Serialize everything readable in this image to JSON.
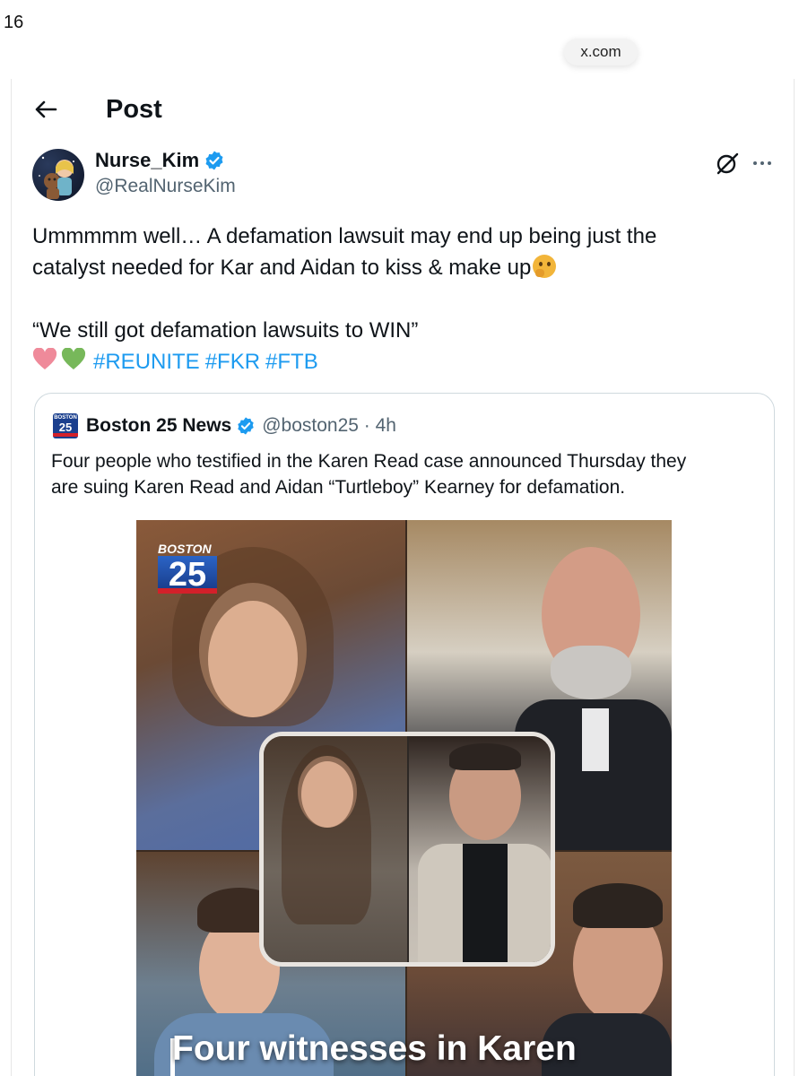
{
  "status": {
    "number": "16",
    "url": "x.com"
  },
  "header": {
    "title": "Post"
  },
  "post": {
    "author_name": "Nurse_Kim",
    "author_handle": "@RealNurseKim",
    "text_line1": "Ummmmm well… A defamation lawsuit may end up being just the",
    "text_line2": "catalyst needed for Kar and Aidan to kiss & make up",
    "quote_line": "“We still got defamation lawsuits to WIN”",
    "hashtags": [
      "#REUNITE",
      "#FKR",
      "#FTB"
    ]
  },
  "quoted": {
    "logo_top": "BOSTON",
    "logo_num": "25",
    "name": "Boston 25 News",
    "handle": "@boston25 · 4h",
    "text_line1": "Four people who testified in the Karen Read case announced Thursday they",
    "text_line2": "are suing Karen Read and Aidan “Turtleboy” Kearney for defamation.",
    "media_badge_top": "BOSTON",
    "media_badge_num": "25",
    "media_headline": "Four witnesses in Karen"
  },
  "colors": {
    "accent": "#1d9bf0",
    "text": "#0f1419",
    "muted": "#536471",
    "border": "#cfd9de"
  },
  "icons": [
    "back-arrow-icon",
    "verified-badge-icon",
    "grok-icon",
    "more-options-icon",
    "thinking-face-emoji",
    "pink-heart-emoji",
    "green-heart-emoji"
  ]
}
